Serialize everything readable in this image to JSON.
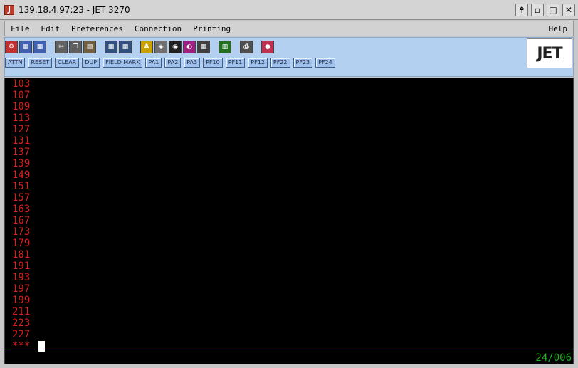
{
  "window": {
    "app_icon_letter": "J",
    "title": "139.18.4.97:23 - JET 3270",
    "controls": [
      "⇞",
      "▫",
      "□",
      "✕"
    ]
  },
  "menu": {
    "items": [
      "File",
      "Edit",
      "Preferences",
      "Connection",
      "Printing"
    ],
    "help": "Help"
  },
  "toolbar": {
    "icons": [
      {
        "name": "connect-icon",
        "glyph": "⚙",
        "color": "#c03030"
      },
      {
        "name": "disconnect-icon",
        "glyph": "▦",
        "color": "#4060b0"
      },
      {
        "name": "reconnect-icon",
        "glyph": "▦",
        "color": "#4060b0"
      },
      {
        "name": "cut-icon",
        "glyph": "✂",
        "color": "#606060"
      },
      {
        "name": "copy-icon",
        "glyph": "❐",
        "color": "#606060"
      },
      {
        "name": "paste-icon",
        "glyph": "▤",
        "color": "#706040"
      },
      {
        "name": "send-file-icon",
        "glyph": "▦",
        "color": "#305080"
      },
      {
        "name": "receive-file-icon",
        "glyph": "▦",
        "color": "#305080"
      },
      {
        "name": "font-icon",
        "glyph": "A",
        "color": "#c8a000"
      },
      {
        "name": "keyboard-map-icon",
        "glyph": "◈",
        "color": "#707070"
      },
      {
        "name": "color-icon",
        "glyph": "◉",
        "color": "#202020"
      },
      {
        "name": "attributes-icon",
        "glyph": "◐",
        "color": "#a02080"
      },
      {
        "name": "grid-icon",
        "glyph": "▦",
        "color": "#404040"
      },
      {
        "name": "macro-icon",
        "glyph": "▥",
        "color": "#207020"
      },
      {
        "name": "print-icon",
        "glyph": "⎙",
        "color": "#505050"
      },
      {
        "name": "print-setup-icon",
        "glyph": "●",
        "color": "#c03050"
      }
    ],
    "keys": [
      "ATTN",
      "RESET",
      "CLEAR",
      "DUP",
      "FIELD MARK",
      "PA1",
      "PA2",
      "PA3",
      "PF10",
      "PF11",
      "PF12",
      "PF22",
      "PF23",
      "PF24"
    ],
    "logo": "JET"
  },
  "terminal": {
    "lines": [
      "103",
      "107",
      "109",
      "113",
      "127",
      "131",
      "137",
      "139",
      "149",
      "151",
      "157",
      "163",
      "167",
      "173",
      "179",
      "181",
      "191",
      "193",
      "197",
      "199",
      "211",
      "223",
      "227"
    ],
    "prompt": "***",
    "status": "24/006",
    "colors": {
      "text": "#d82020",
      "status": "#20b020",
      "background": "#000000"
    }
  }
}
